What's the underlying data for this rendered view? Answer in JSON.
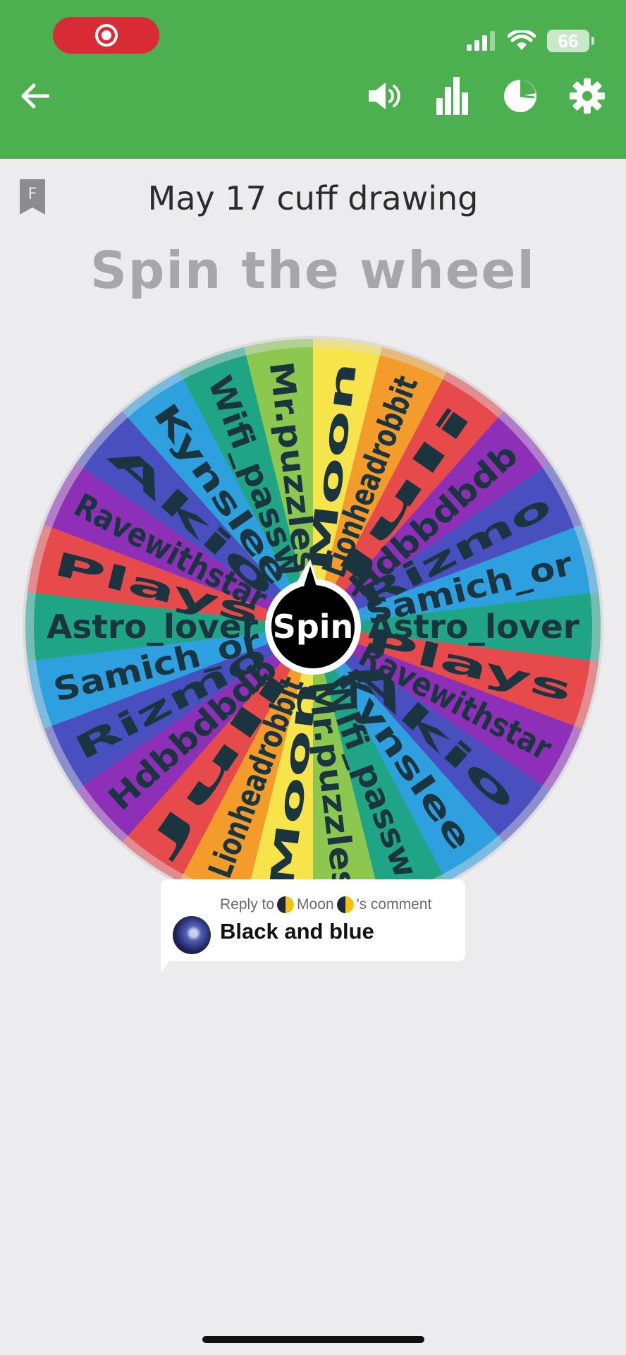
{
  "window": {
    "title": "May 17 cuff drawing",
    "heading": "Spin the wheel",
    "bookmark_letter": "F"
  },
  "status_bar": {
    "battery": "66",
    "recording": true
  },
  "toolbar": {
    "icons": [
      "back-arrow-icon",
      "volume-icon",
      "bar-chart-icon",
      "pie-chart-icon",
      "gear-icon"
    ]
  },
  "wheel": {
    "center_label": "Spin",
    "entries": [
      "Moon",
      "Lionheadrobbit",
      "Juli",
      "Hdbbdbdb",
      "Rizmo",
      "Samich_or",
      "Astro_lover",
      "Plays",
      "Ravewithstar",
      "Akio",
      "Kynslee",
      "Wifi_passw",
      "Mr.puzzles",
      "Moon",
      "Lionheadrobbit",
      "Juli",
      "Hdbbdbdb",
      "Rizmo",
      "Samich_or",
      "Astro_lover",
      "Plays",
      "Ravewithstar",
      "Akio",
      "Kynslee",
      "Wifi_passw",
      "Mr.puzzles"
    ],
    "colors": [
      "#f7e34a",
      "#f39c2c",
      "#e64a4a",
      "#8e2fb8",
      "#4a4fbf",
      "#2ea0e0",
      "#1fa486",
      "#e64a4a",
      "#8e2fb8",
      "#4a4fbf",
      "#2ea0e0",
      "#1fa486",
      "#8cc850"
    ],
    "text_color": "#1b3540"
  },
  "reply": {
    "prefix": "Reply to",
    "name": "Moon",
    "suffix": "'s comment",
    "text": "Black and blue"
  }
}
